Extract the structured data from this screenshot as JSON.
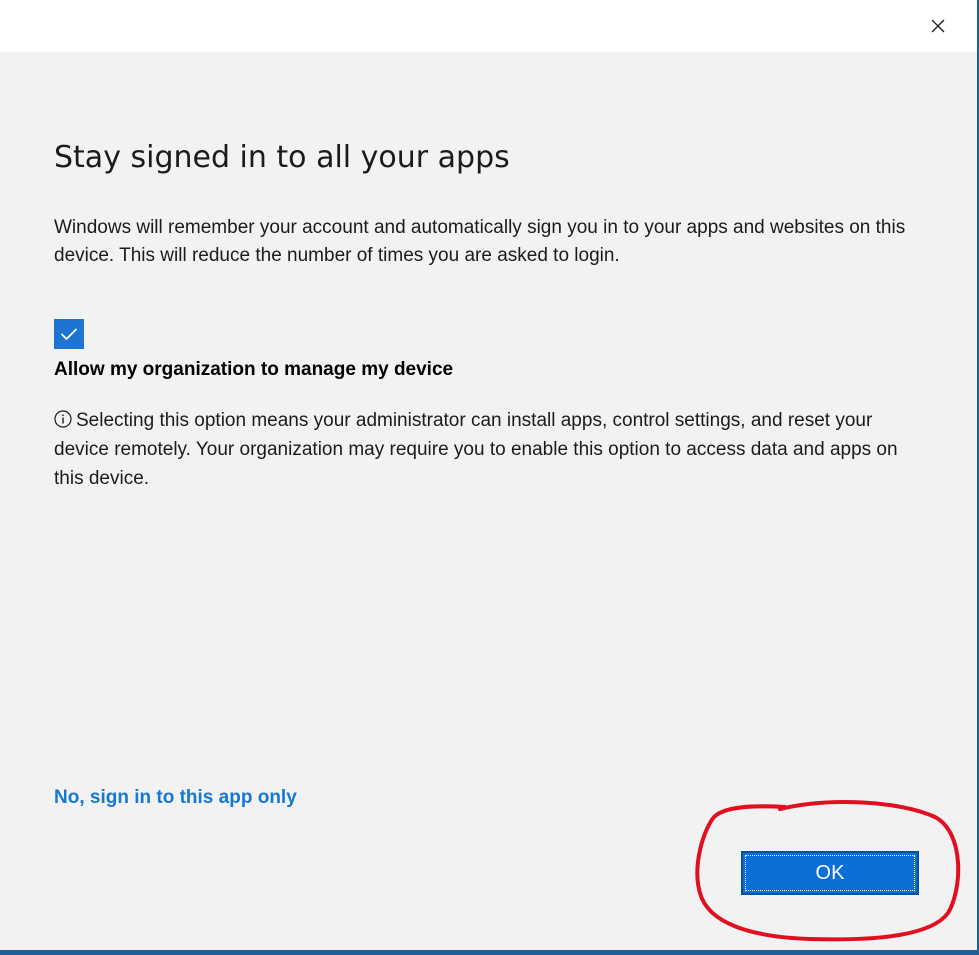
{
  "dialog": {
    "close_icon": "close-icon",
    "title": "Stay signed in to all your apps",
    "description": "Windows will remember your account and automatically sign you in to your apps and websites on this device. This will reduce the number of times you are asked to login.",
    "checkbox": {
      "checked": true,
      "label": "Allow my organization to manage my device"
    },
    "info_icon": "info-icon",
    "info_text": "Selecting this option means your administrator can install apps, control settings, and reset your device remotely. Your organization may require you to enable this option to access data and apps on this device.",
    "link_text": "No, sign in to this app only",
    "ok_label": "OK"
  },
  "colors": {
    "accent": "#0a6fd6",
    "link": "#1778d1",
    "checkbox": "#1e74d2",
    "window_border": "#1f5f97",
    "annotation": "#e01020"
  }
}
